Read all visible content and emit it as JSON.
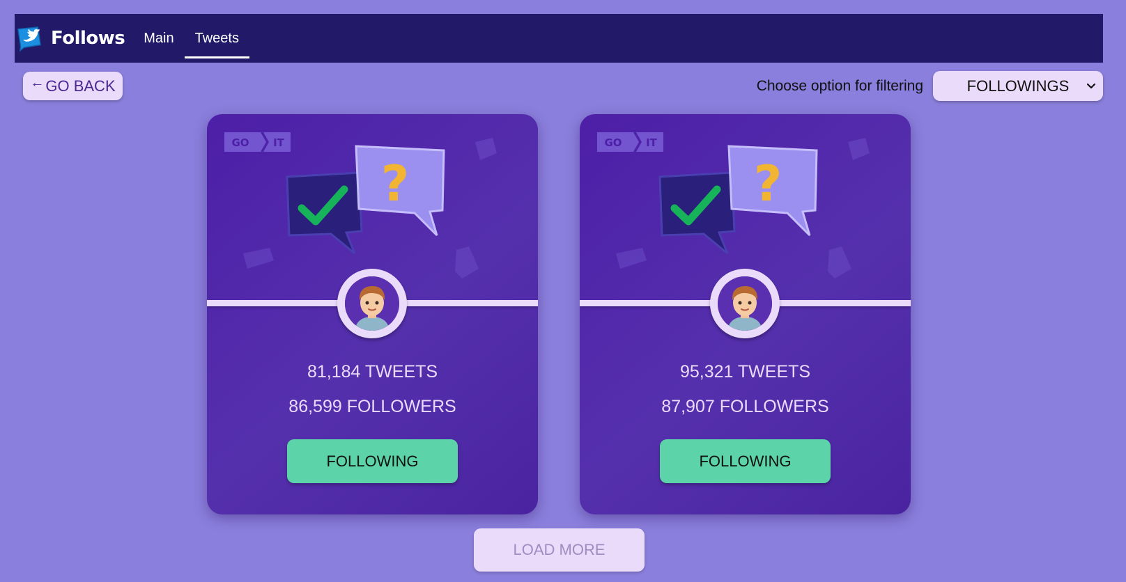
{
  "header": {
    "brand": "Follows",
    "nav": [
      {
        "label": "Main",
        "active": false
      },
      {
        "label": "Tweets",
        "active": true
      }
    ]
  },
  "toolbar": {
    "back_arrow": "←",
    "back_label": "GO BACK",
    "filter_label": "Choose option for filtering",
    "filter_selected": "FOLLOWINGS"
  },
  "cards": [
    {
      "tweets": "81,184 TWEETS",
      "followers": "86,599 FOLLOWERS",
      "button": "FOLLOWING"
    },
    {
      "tweets": "95,321 TWEETS",
      "followers": "87,907 FOLLOWERS",
      "button": "FOLLOWING"
    }
  ],
  "card_logo": {
    "left": "GO",
    "right": "IT"
  },
  "load_more_label": "LOAD MORE",
  "colors": {
    "page_bg": "#8a7fdc",
    "navbar_bg": "#221a69",
    "card_bg": "#5530ad",
    "accent_light": "#ebdbfb",
    "button_green": "#5cd3a8"
  },
  "icons": [
    "twitter-logo-icon",
    "back-arrow-icon",
    "chevron-down-icon",
    "check-bubble-icon",
    "question-bubble-icon",
    "avatar-icon"
  ]
}
